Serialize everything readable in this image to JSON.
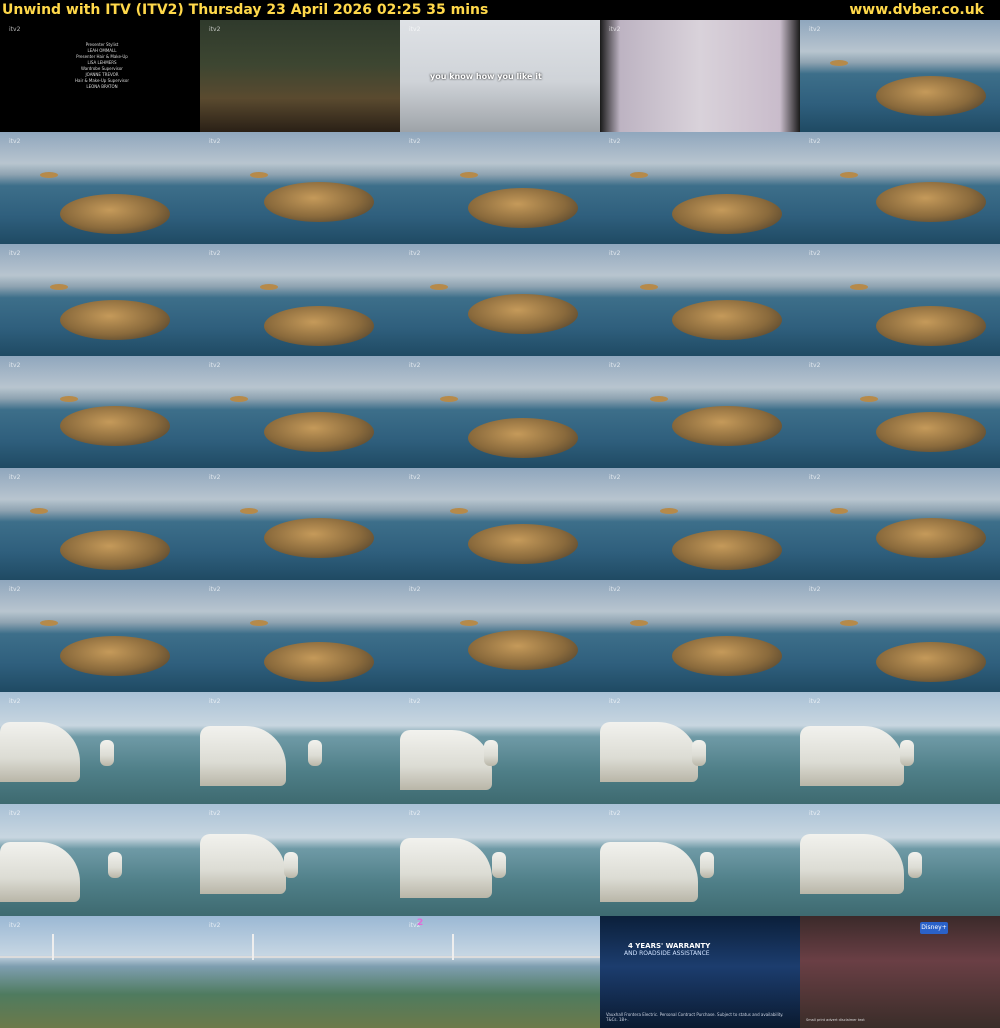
{
  "header": {
    "title": "Unwind with ITV (ITV2)    Thursday 23 April 2026  02:25  35 mins",
    "site": "www.dvber.co.uk"
  },
  "watermark": "itv2",
  "thumbnails": [
    {
      "scene": "credits",
      "text": [
        "Presenter Stylist",
        "LEAH OMMALL",
        "Presenter Hair & Make-Up",
        "LISA LEHMERS",
        "Wardrobe Supervisor",
        "JOANNE TREVOR",
        "Hair & Make-Up Supervisor",
        "LEONA BRATON"
      ]
    },
    {
      "scene": "dinner"
    },
    {
      "scene": "office",
      "caption": "you know how you like it"
    },
    {
      "scene": "window"
    },
    {
      "scene": "aerial"
    },
    {
      "scene": "aerial"
    },
    {
      "scene": "aerial"
    },
    {
      "scene": "aerial"
    },
    {
      "scene": "aerial"
    },
    {
      "scene": "aerial"
    },
    {
      "scene": "aerial"
    },
    {
      "scene": "aerial"
    },
    {
      "scene": "aerial"
    },
    {
      "scene": "aerial"
    },
    {
      "scene": "aerial"
    },
    {
      "scene": "aerial"
    },
    {
      "scene": "aerial"
    },
    {
      "scene": "aerial"
    },
    {
      "scene": "aerial"
    },
    {
      "scene": "aerial"
    },
    {
      "scene": "aerial"
    },
    {
      "scene": "aerial"
    },
    {
      "scene": "aerial"
    },
    {
      "scene": "aerial"
    },
    {
      "scene": "aerial"
    },
    {
      "scene": "aerial"
    },
    {
      "scene": "aerial"
    },
    {
      "scene": "aerial"
    },
    {
      "scene": "aerial"
    },
    {
      "scene": "aerial"
    },
    {
      "scene": "cliffs"
    },
    {
      "scene": "cliffs"
    },
    {
      "scene": "cliffs"
    },
    {
      "scene": "cliffs"
    },
    {
      "scene": "cliffs"
    },
    {
      "scene": "cliffs"
    },
    {
      "scene": "cliffs"
    },
    {
      "scene": "cliffs"
    },
    {
      "scene": "cliffs"
    },
    {
      "scene": "cliffs"
    },
    {
      "scene": "bridge"
    },
    {
      "scene": "bridge"
    },
    {
      "scene": "bridge",
      "overlay": "2"
    },
    {
      "scene": "ad",
      "line1": "4 YEARS' WARRANTY",
      "line2": "AND ROADSIDE ASSISTANCE",
      "fine": "Vauxhall Frontera Electric. Personal Contract Purchase. Subject to status and availability. T&Cs. 18+."
    },
    {
      "scene": "store",
      "badge": "Disney+",
      "fine": "Small print advert disclaimer text"
    }
  ]
}
